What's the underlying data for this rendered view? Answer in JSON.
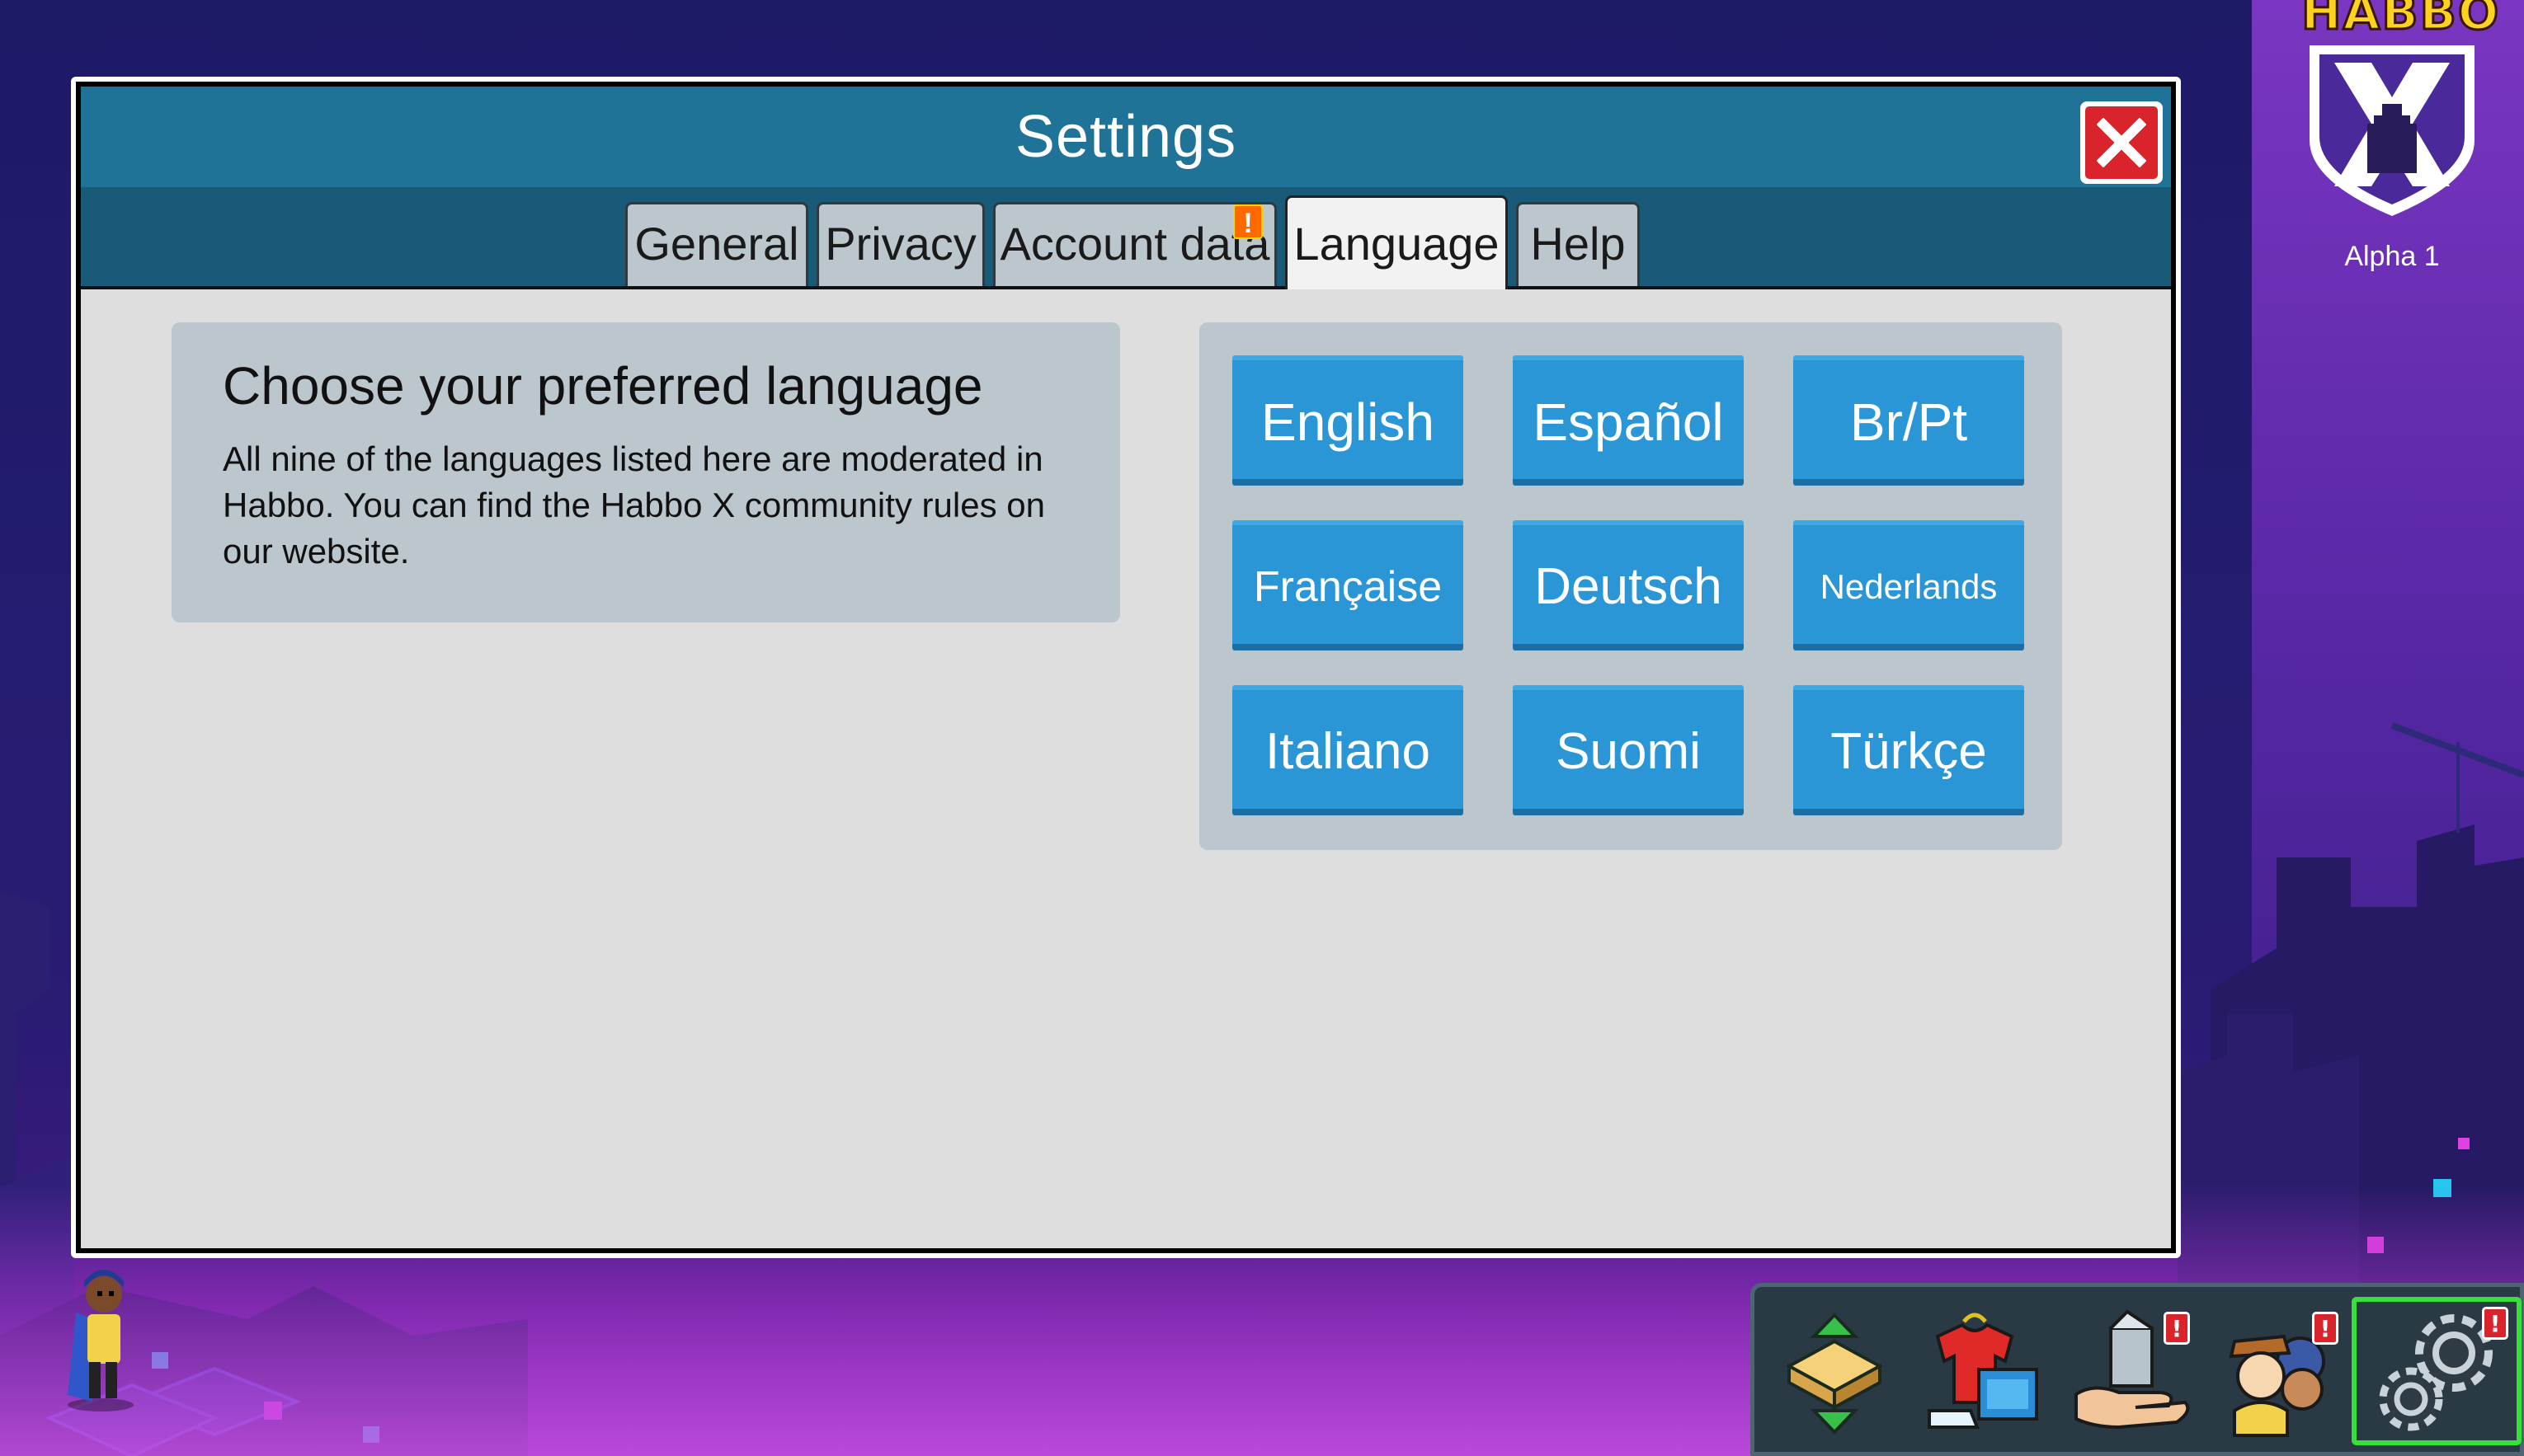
{
  "brand": {
    "wordmark": "HABBO",
    "hotel_label": "Alpha 1"
  },
  "window": {
    "title": "Settings",
    "close_icon": "close-icon"
  },
  "tabs": [
    {
      "label": "General",
      "active": false
    },
    {
      "label": "Privacy",
      "active": false
    },
    {
      "label": "Account data",
      "active": false,
      "alert": "!"
    },
    {
      "label": "Language",
      "active": true
    },
    {
      "label": "Help",
      "active": false
    }
  ],
  "language_panel": {
    "heading": "Choose your preferred language",
    "description": "All nine of the languages listed here are moderated in Habbo. You can find the Habbo X community rules on our website.",
    "languages": [
      {
        "label": "English"
      },
      {
        "label": "Español"
      },
      {
        "label": "Br/Pt"
      },
      {
        "label": "Française"
      },
      {
        "label": "Deutsch"
      },
      {
        "label": "Nederlands"
      },
      {
        "label": "Italiano"
      },
      {
        "label": "Suomi"
      },
      {
        "label": "Türkçe"
      }
    ]
  },
  "toolbar": {
    "items": [
      {
        "icon": "room-navigator-icon"
      },
      {
        "icon": "wardrobe-catalog-icon"
      },
      {
        "icon": "inventory-hand-icon",
        "alert": "!"
      },
      {
        "icon": "friends-icon",
        "alert": "!"
      },
      {
        "icon": "settings-gear-icon",
        "alert": "!",
        "selected": true
      }
    ]
  },
  "colors": {
    "titlebar": "#1e7397",
    "tabbar": "#185a77",
    "lang_button": "#2a96d6",
    "panel": "#bcc6cd",
    "content_bg": "#dedede",
    "close": "#d9242b",
    "highlight": "#36e23a"
  }
}
